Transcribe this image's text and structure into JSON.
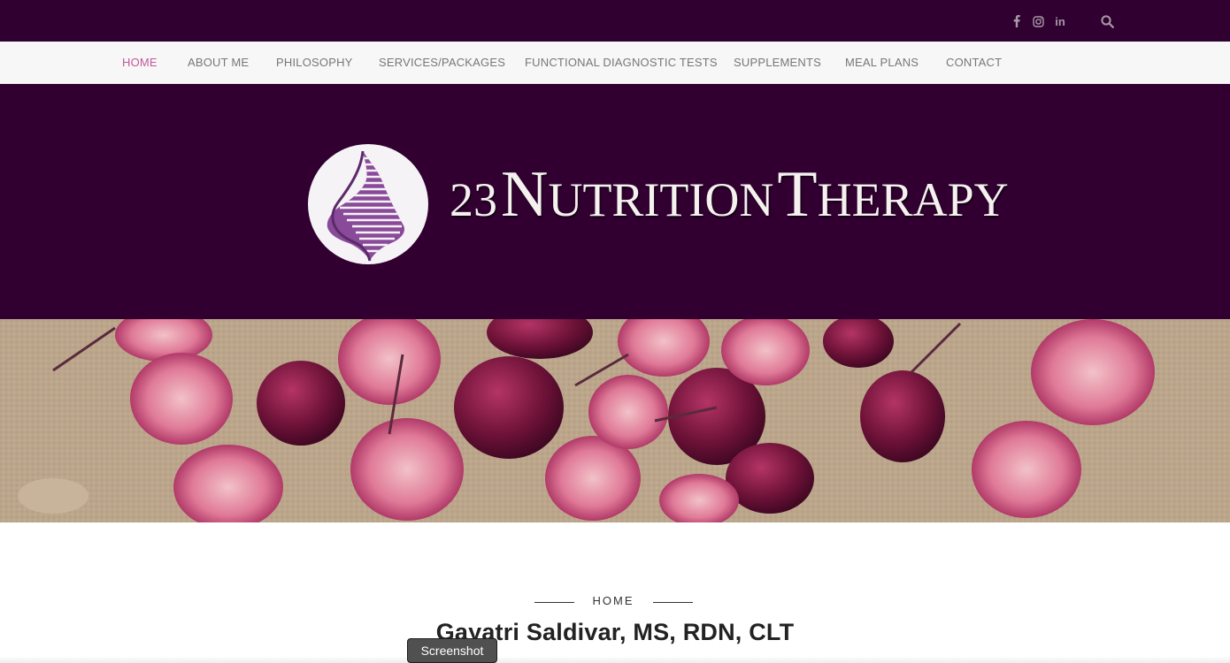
{
  "colors": {
    "topbar": "#2f0030",
    "nav_bg": "#f7f7f7",
    "nav_active": "#c05a98",
    "nav_text": "#777777",
    "hero_bg": "#310031",
    "logo_purple": "#8a4a9a"
  },
  "topbar": {
    "icons": [
      "facebook-icon",
      "instagram-icon",
      "linkedin-icon",
      "search-icon"
    ],
    "linkedin_text": "in"
  },
  "nav": {
    "items": [
      {
        "label": "HOME",
        "active": true
      },
      {
        "label": "ABOUT ME",
        "active": false
      },
      {
        "label": "PHILOSOPHY",
        "active": false
      },
      {
        "label": "SERVICES/PACKAGES",
        "active": false
      },
      {
        "label": "FUNCTIONAL DIAGNOSTIC TESTS",
        "active": false
      },
      {
        "label": "SUPPLEMENTS",
        "active": false
      },
      {
        "label": "MEAL PLANS",
        "active": false
      },
      {
        "label": "CONTACT",
        "active": false
      }
    ]
  },
  "hero": {
    "brand_number": "23",
    "brand_word1_initial": "N",
    "brand_word1_rest": "UTRITION",
    "brand_word2_initial": "T",
    "brand_word2_rest": "HERAPY"
  },
  "content": {
    "breadcrumb": "HOME",
    "headline": "Gayatri Saldivar, MS, RDN, CLT"
  },
  "overlay": {
    "badge": "Screenshot"
  }
}
